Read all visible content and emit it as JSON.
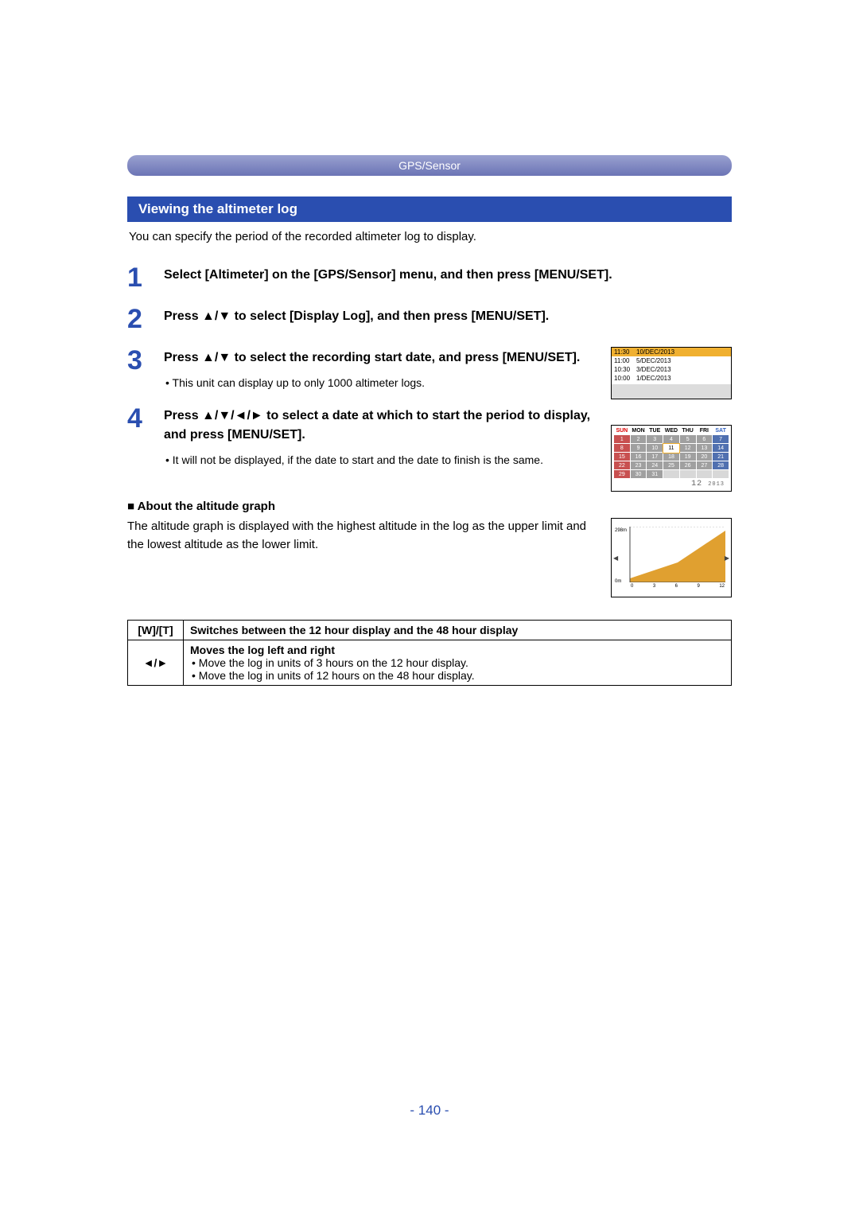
{
  "header": "GPS/Sensor",
  "section_title": "Viewing the altimeter log",
  "intro": "You can specify the period of the recorded altimeter log to display.",
  "steps": [
    {
      "num": "1",
      "text": "Select [Altimeter] on the [GPS/Sensor] menu, and then press [MENU/SET]."
    },
    {
      "num": "2",
      "text": "Press ▲/▼ to select [Display Log], and then press [MENU/SET]."
    },
    {
      "num": "3",
      "text": "Press ▲/▼ to select the recording start date, and press [MENU/SET].",
      "note": "This unit can display up to only 1000 altimeter logs."
    },
    {
      "num": "4",
      "text": "Press ▲/▼/◄/► to select a date at which to start the period to display, and press [MENU/SET].",
      "note": "It will not be displayed, if the date to start and the date to finish is the same."
    }
  ],
  "loglist": [
    {
      "time": "11:30",
      "date": "10/DEC/2013",
      "sel": true
    },
    {
      "time": "11:00",
      "date": " 5/DEC/2013",
      "sel": false
    },
    {
      "time": "10:30",
      "date": " 3/DEC/2013",
      "sel": false
    },
    {
      "time": "10:00",
      "date": " 1/DEC/2013",
      "sel": false
    }
  ],
  "calendar": {
    "dow": [
      "SUN",
      "MON",
      "TUE",
      "WED",
      "THU",
      "FRI",
      "SAT"
    ],
    "rows": [
      [
        "1",
        "2",
        "3",
        "4",
        "5",
        "6",
        "7"
      ],
      [
        "8",
        "9",
        "10",
        "11",
        "12",
        "13",
        "14"
      ],
      [
        "15",
        "16",
        "17",
        "18",
        "19",
        "20",
        "21"
      ],
      [
        "22",
        "23",
        "24",
        "25",
        "26",
        "27",
        "28"
      ],
      [
        "29",
        "30",
        "31",
        "",
        "",
        "",
        ""
      ]
    ],
    "today": "11",
    "month": "12",
    "year": "2013"
  },
  "about": {
    "title": "About the altitude graph",
    "text": "The altitude graph is displayed with the highest altitude in the log as the upper limit and the lowest altitude as the lower limit."
  },
  "chart_data": {
    "type": "area",
    "x": [
      0,
      3,
      6,
      9,
      12
    ],
    "y": [
      50,
      80,
      120,
      180,
      270
    ],
    "ylim": [
      0,
      298
    ],
    "xlabel": "",
    "ylabel": "",
    "y_top_label": "298m",
    "y_bot_label": "0m",
    "x_ticks": [
      "0",
      "3",
      "6",
      "9",
      "12"
    ]
  },
  "ops": {
    "row1_key": "[W]/[T]",
    "row1_text": "Switches between the 12 hour display and the 48 hour display",
    "row2_key": "◄/►",
    "row2_title": "Moves the log left and right",
    "row2_sub1": "Move the log in units of 3 hours on the 12 hour display.",
    "row2_sub2": "Move the log in units of 12 hours on the 48 hour display."
  },
  "page_number": "- 140 -"
}
